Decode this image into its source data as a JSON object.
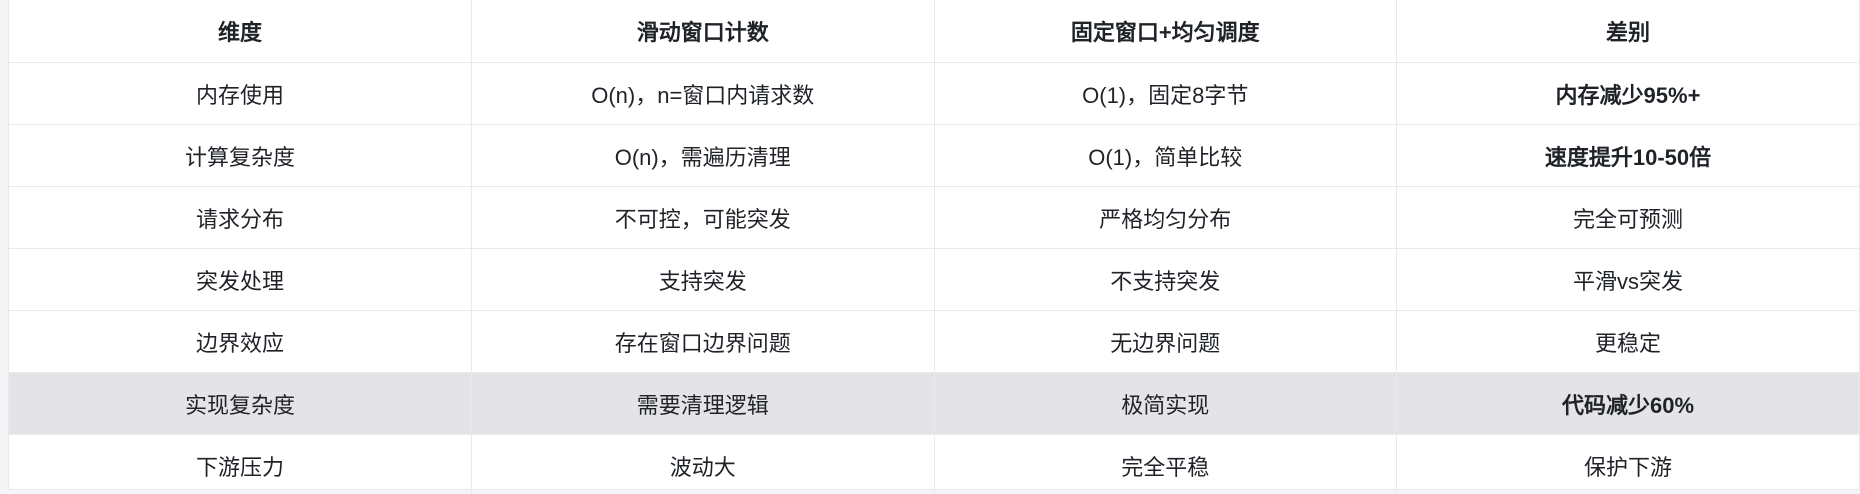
{
  "table": {
    "headers": [
      "维度",
      "滑动窗口计数",
      "固定窗口+均匀调度",
      "差别"
    ],
    "rows": [
      [
        "内存使用",
        "O(n)，n=窗口内请求数",
        "O(1)，固定8字节",
        "内存减少95%+"
      ],
      [
        "计算复杂度",
        "O(n)，需遍历清理",
        "O(1)，简单比较",
        "速度提升10-50倍"
      ],
      [
        "请求分布",
        "不可控，可能突发",
        "严格均匀分布",
        "完全可预测"
      ],
      [
        "突发处理",
        "支持突发",
        "不支持突发",
        "平滑vs突发"
      ],
      [
        "边界效应",
        "存在窗口边界问题",
        "无边界问题",
        "更稳定"
      ],
      [
        "实现复杂度",
        "需要清理逻辑",
        "极简实现",
        "代码减少60%"
      ],
      [
        "下游压力",
        "波动大",
        "完全平稳",
        "保护下游"
      ]
    ],
    "highlighted_row_index": 5,
    "highlight_color": "#e4e4e6"
  }
}
